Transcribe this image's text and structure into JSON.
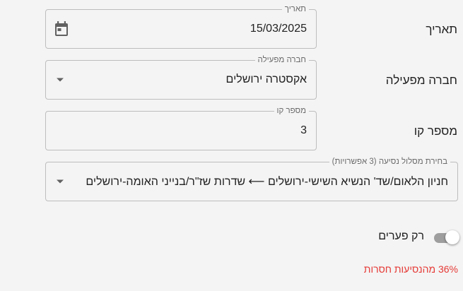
{
  "form": {
    "date": {
      "row_label": "תאריך",
      "legend": "תאריך",
      "value": "15/03/2025",
      "icon": "calendar-icon"
    },
    "operator": {
      "row_label": "חברה מפעילה",
      "legend": "חברה מפעילה",
      "value": "אקסטרה ירושלים",
      "icon": "dropdown-caret-icon"
    },
    "line_number": {
      "row_label": "מספר קו",
      "legend": "מספר קו",
      "value": "3"
    },
    "route": {
      "legend": "בחירת מסלול נסיעה (3 אפשרויות)",
      "value": "חניון הלאום/שד' הנשיא השישי-ירושלים ⟵ שדרות שז\"ר/בנייני האומה-ירושלים",
      "icon": "dropdown-caret-icon"
    }
  },
  "gaps_toggle": {
    "label": "רק פערים",
    "checked": false
  },
  "missing_stat": {
    "text": "36% מהנסיעות חסרות",
    "percent": 36,
    "color": "#e53935"
  },
  "colors": {
    "background": "#f4f4f4",
    "field_border": "#bdbdbd",
    "icon": "#616161"
  }
}
